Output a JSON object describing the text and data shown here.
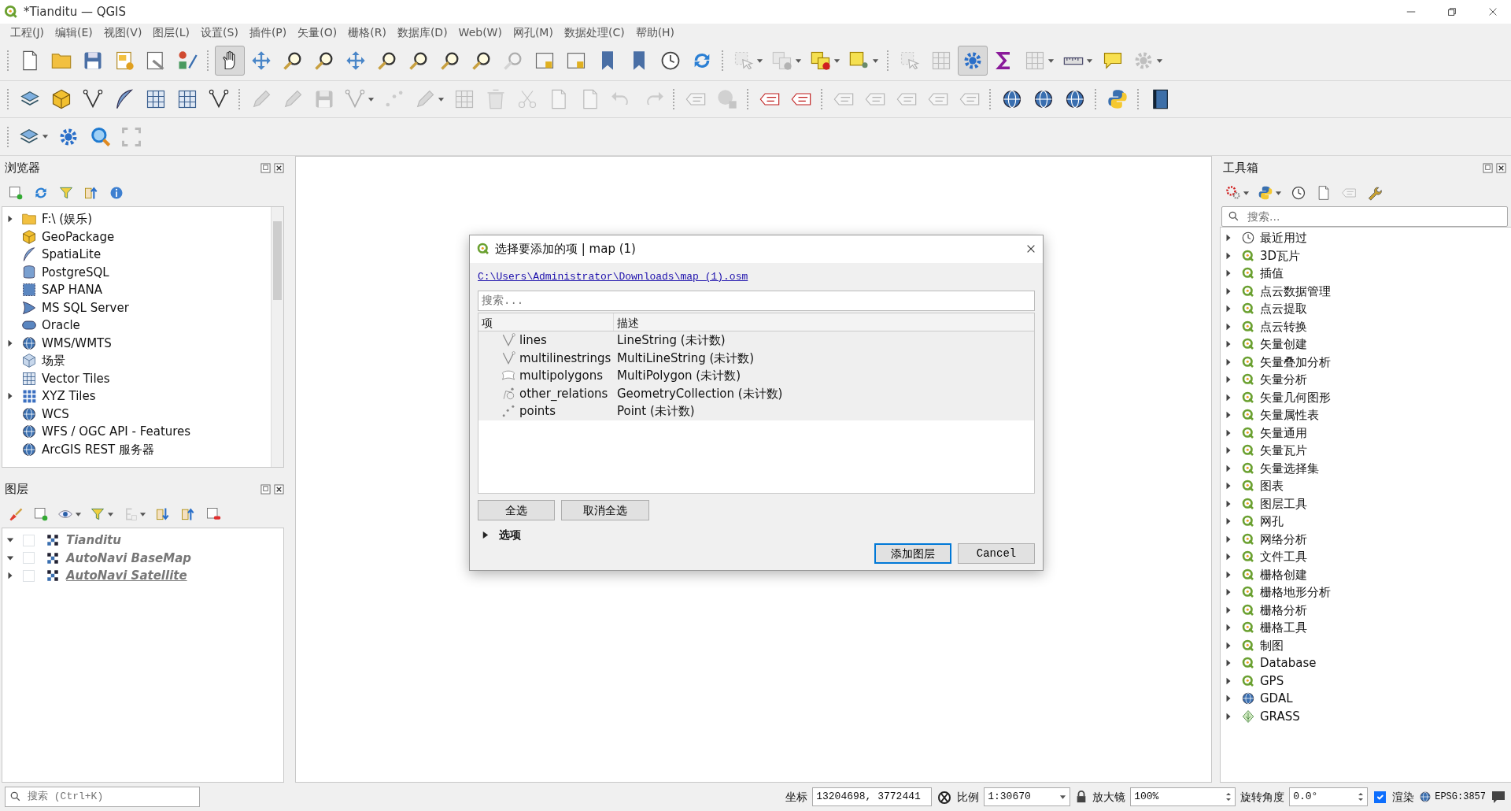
{
  "window": {
    "title": "*Tianditu — QGIS"
  },
  "menu": [
    "工程(J)",
    "编辑(E)",
    "视图(V)",
    "图层(L)",
    "设置(S)",
    "插件(P)",
    "矢量(O)",
    "栅格(R)",
    "数据库(D)",
    "Web(W)",
    "网孔(M)",
    "数据处理(C)",
    "帮助(H)"
  ],
  "toolbars": [
    {
      "groups": [
        [
          {
            "kind": "page",
            "disabled": false,
            "active": false,
            "dropdown": false
          },
          {
            "kind": "folder",
            "disabled": false,
            "active": false,
            "dropdown": false
          },
          {
            "kind": "floppy",
            "disabled": false,
            "active": false,
            "dropdown": false
          },
          {
            "kind": "layout",
            "disabled": false,
            "active": false,
            "dropdown": false
          },
          {
            "kind": "layout-manager",
            "disabled": false,
            "active": false,
            "dropdown": false
          },
          {
            "kind": "style",
            "disabled": false,
            "active": false,
            "dropdown": false
          }
        ],
        [
          {
            "kind": "hand",
            "disabled": false,
            "active": true,
            "dropdown": false
          },
          {
            "kind": "arrows",
            "disabled": false,
            "active": false,
            "dropdown": false
          },
          {
            "kind": "magnifier",
            "disabled": false,
            "active": false,
            "dropdown": false
          },
          {
            "kind": "magnifier",
            "disabled": false,
            "active": false,
            "dropdown": false
          },
          {
            "kind": "arrows",
            "disabled": false,
            "active": false,
            "dropdown": false
          },
          {
            "kind": "magnifier",
            "disabled": false,
            "active": false,
            "dropdown": false
          },
          {
            "kind": "magnifier",
            "disabled": false,
            "active": false,
            "dropdown": false
          },
          {
            "kind": "magnifier",
            "disabled": false,
            "active": false,
            "dropdown": false
          },
          {
            "kind": "magnifier",
            "disabled": false,
            "active": false,
            "dropdown": false
          },
          {
            "kind": "magnifier",
            "disabled": true,
            "active": false,
            "dropdown": false
          },
          {
            "kind": "window",
            "disabled": false,
            "active": false,
            "dropdown": false
          },
          {
            "kind": "window",
            "disabled": false,
            "active": false,
            "dropdown": false
          },
          {
            "kind": "bookmark",
            "disabled": false,
            "active": false,
            "dropdown": false
          },
          {
            "kind": "bookmark",
            "disabled": false,
            "active": false,
            "dropdown": false
          },
          {
            "kind": "clock",
            "disabled": false,
            "active": false,
            "dropdown": false
          },
          {
            "kind": "refresh",
            "disabled": false,
            "active": false,
            "dropdown": false
          }
        ],
        [
          {
            "kind": "cursor",
            "disabled": true,
            "active": false,
            "dropdown": true
          },
          {
            "kind": "squares",
            "disabled": true,
            "active": false,
            "dropdown": true
          },
          {
            "kind": "squares",
            "disabled": false,
            "active": false,
            "dropdown": true
          },
          {
            "kind": "square-pin",
            "disabled": false,
            "active": false,
            "dropdown": true
          }
        ],
        [
          {
            "kind": "cursor",
            "disabled": true,
            "active": false,
            "dropdown": false
          },
          {
            "kind": "grid",
            "disabled": true,
            "active": false,
            "dropdown": false
          },
          {
            "kind": "gear",
            "disabled": false,
            "active": true,
            "dropdown": false
          },
          {
            "kind": "sigma",
            "disabled": false,
            "active": false,
            "dropdown": false
          },
          {
            "kind": "grid",
            "disabled": true,
            "active": false,
            "dropdown": true
          },
          {
            "kind": "ruler",
            "disabled": false,
            "active": false,
            "dropdown": true
          },
          {
            "kind": "speech",
            "disabled": false,
            "active": false,
            "dropdown": false
          },
          {
            "kind": "gear",
            "disabled": true,
            "active": false,
            "dropdown": true
          }
        ]
      ]
    },
    {
      "groups": [
        [
          {
            "kind": "layers",
            "disabled": false,
            "active": false,
            "dropdown": false
          },
          {
            "kind": "cube",
            "disabled": false,
            "active": false,
            "dropdown": false
          },
          {
            "kind": "polyline",
            "disabled": false,
            "active": false,
            "dropdown": false
          },
          {
            "kind": "feather",
            "disabled": false,
            "active": false,
            "dropdown": false
          },
          {
            "kind": "grid",
            "disabled": false,
            "active": false,
            "dropdown": false
          },
          {
            "kind": "grid",
            "disabled": false,
            "active": false,
            "dropdown": false
          },
          {
            "kind": "polyline",
            "disabled": false,
            "active": false,
            "dropdown": false
          }
        ],
        [
          {
            "kind": "pencil",
            "disabled": true,
            "active": false,
            "dropdown": false
          },
          {
            "kind": "pencil",
            "disabled": true,
            "active": false,
            "dropdown": false
          },
          {
            "kind": "floppy",
            "disabled": true,
            "active": false,
            "dropdown": false
          },
          {
            "kind": "polyline",
            "disabled": true,
            "active": false,
            "dropdown": true
          },
          {
            "kind": "points",
            "disabled": true,
            "active": false,
            "dropdown": false
          },
          {
            "kind": "pencil",
            "disabled": true,
            "active": false,
            "dropdown": true
          },
          {
            "kind": "grid",
            "disabled": true,
            "active": false,
            "dropdown": false
          },
          {
            "kind": "trash",
            "disabled": true,
            "active": false,
            "dropdown": false
          },
          {
            "kind": "scissors",
            "disabled": true,
            "active": false,
            "dropdown": false
          },
          {
            "kind": "page",
            "disabled": true,
            "active": false,
            "dropdown": false
          },
          {
            "kind": "page",
            "disabled": true,
            "active": false,
            "dropdown": false
          },
          {
            "kind": "undo",
            "disabled": true,
            "active": false,
            "dropdown": false
          },
          {
            "kind": "redo",
            "disabled": true,
            "active": false,
            "dropdown": false
          }
        ],
        [
          {
            "kind": "tag",
            "disabled": true,
            "active": false,
            "dropdown": false
          },
          {
            "kind": "pie",
            "disabled": true,
            "active": false,
            "dropdown": false
          }
        ],
        [
          {
            "kind": "tag",
            "disabled": false,
            "active": false,
            "dropdown": false
          },
          {
            "kind": "tag",
            "disabled": false,
            "active": false,
            "dropdown": false
          }
        ],
        [
          {
            "kind": "tag",
            "disabled": true,
            "active": false,
            "dropdown": false
          },
          {
            "kind": "tag",
            "disabled": true,
            "active": false,
            "dropdown": false
          },
          {
            "kind": "tag",
            "disabled": true,
            "active": false,
            "dropdown": false
          },
          {
            "kind": "tag",
            "disabled": true,
            "active": false,
            "dropdown": false
          },
          {
            "kind": "tag",
            "disabled": true,
            "active": false,
            "dropdown": false
          }
        ],
        [
          {
            "kind": "globe",
            "disabled": false,
            "active": false,
            "dropdown": false
          },
          {
            "kind": "globe",
            "disabled": false,
            "active": false,
            "dropdown": false
          },
          {
            "kind": "globe",
            "disabled": false,
            "active": false,
            "dropdown": false
          }
        ],
        [
          {
            "kind": "python",
            "disabled": false,
            "active": false,
            "dropdown": false
          }
        ],
        [
          {
            "kind": "book",
            "disabled": false,
            "active": false,
            "dropdown": false
          }
        ]
      ]
    },
    {
      "groups": [
        [
          {
            "kind": "layers",
            "disabled": false,
            "active": false,
            "dropdown": true
          },
          {
            "kind": "gear",
            "disabled": false,
            "active": false,
            "dropdown": false
          },
          {
            "kind": "search",
            "disabled": false,
            "active": false,
            "dropdown": false
          },
          {
            "kind": "frame",
            "disabled": true,
            "active": false,
            "dropdown": false
          }
        ]
      ]
    }
  ],
  "browser_panel": {
    "title": "浏览器",
    "tools": [
      {
        "kind": "square-plus",
        "disabled": false,
        "dropdown": false
      },
      {
        "kind": "refresh",
        "disabled": false,
        "dropdown": false
      },
      {
        "kind": "filter",
        "disabled": false,
        "dropdown": false
      },
      {
        "kind": "collapse",
        "disabled": false,
        "dropdown": false
      },
      {
        "kind": "info",
        "disabled": false,
        "dropdown": false
      }
    ],
    "items": [
      {
        "label": "F:\\ (娱乐)",
        "kind": "folder",
        "expandable": true
      },
      {
        "label": "GeoPackage",
        "kind": "cube",
        "expandable": false
      },
      {
        "label": "SpatiaLite",
        "kind": "feather",
        "expandable": false
      },
      {
        "label": "PostgreSQL",
        "kind": "database",
        "expandable": false
      },
      {
        "label": "SAP HANA",
        "kind": "dotted-square",
        "expandable": false
      },
      {
        "label": "MS SQL Server",
        "kind": "sail",
        "expandable": false
      },
      {
        "label": "Oracle",
        "kind": "capsule",
        "expandable": false
      },
      {
        "label": "WMS/WMTS",
        "kind": "globe",
        "expandable": true
      },
      {
        "label": "场景",
        "kind": "box",
        "expandable": false
      },
      {
        "label": "Vector Tiles",
        "kind": "grid",
        "expandable": false
      },
      {
        "label": "XYZ Tiles",
        "kind": "dot-grid",
        "expandable": true
      },
      {
        "label": "WCS",
        "kind": "globe",
        "expandable": false
      },
      {
        "label": "WFS / OGC API - Features",
        "kind": "globe",
        "expandable": false
      },
      {
        "label": "ArcGIS REST 服务器",
        "kind": "globe",
        "expandable": false
      }
    ]
  },
  "layers_panel": {
    "title": "图层",
    "tools": [
      {
        "kind": "brush",
        "disabled": false,
        "dropdown": false
      },
      {
        "kind": "square-plus",
        "disabled": false,
        "dropdown": false
      },
      {
        "kind": "eye",
        "disabled": false,
        "dropdown": true
      },
      {
        "kind": "filter",
        "disabled": false,
        "dropdown": true
      },
      {
        "kind": "expression",
        "disabled": true,
        "dropdown": true
      },
      {
        "kind": "expand",
        "disabled": false,
        "dropdown": false
      },
      {
        "kind": "collapse",
        "disabled": false,
        "dropdown": false
      },
      {
        "kind": "square-minus",
        "disabled": false,
        "dropdown": false
      }
    ],
    "layers": [
      {
        "label": "Tianditu",
        "expanded": true,
        "checked": false,
        "underlined": false
      },
      {
        "label": "AutoNavi BaseMap",
        "expanded": true,
        "checked": false,
        "underlined": false
      },
      {
        "label": "AutoNavi Satellite",
        "expanded": false,
        "checked": false,
        "underlined": true
      }
    ]
  },
  "dialog": {
    "title": "选择要添加的项 | map (1)",
    "path": "C:\\Users\\Administrator\\Downloads\\map (1).osm",
    "search": {
      "placeholder": "搜索..."
    },
    "columns": [
      "项",
      "描述"
    ],
    "rows": [
      {
        "kind": "line",
        "item": "lines",
        "description": "LineString (未计数)"
      },
      {
        "kind": "line",
        "item": "multilinestrings",
        "description": "MultiLineString (未计数)"
      },
      {
        "kind": "polygon",
        "item": "multipolygons",
        "description": "MultiPolygon (未计数)"
      },
      {
        "kind": "collection",
        "item": "other_relations",
        "description": "GeometryCollection (未计数)"
      },
      {
        "kind": "point",
        "item": "points",
        "description": "Point (未计数)"
      }
    ],
    "select_buttons": [
      "全选",
      "取消全选"
    ],
    "options": {
      "label": "选项",
      "expanded": false
    },
    "buttons": [
      {
        "label": "添加图层",
        "default": true
      },
      {
        "label": "Cancel",
        "default": false
      }
    ]
  },
  "toolbox_panel": {
    "title": "工具箱",
    "tools": [
      {
        "kind": "gears",
        "disabled": false,
        "dropdown": true
      },
      {
        "kind": "python",
        "disabled": false,
        "dropdown": true
      },
      {
        "kind": "clock",
        "disabled": false,
        "dropdown": false
      },
      {
        "kind": "page",
        "disabled": false,
        "dropdown": false
      },
      {
        "kind": "tag",
        "disabled": true,
        "dropdown": false
      },
      {
        "kind": "wrench",
        "disabled": false,
        "dropdown": false
      }
    ],
    "search": {
      "placeholder": "搜索..."
    },
    "items": [
      {
        "label": "最近用过",
        "kind": "clock",
        "expanded": false
      },
      {
        "label": "3D瓦片",
        "kind": "qgis",
        "expanded": false
      },
      {
        "label": "插值",
        "kind": "qgis",
        "expanded": false
      },
      {
        "label": "点云数据管理",
        "kind": "qgis",
        "expanded": false
      },
      {
        "label": "点云提取",
        "kind": "qgis",
        "expanded": false
      },
      {
        "label": "点云转换",
        "kind": "qgis",
        "expanded": false
      },
      {
        "label": "矢量创建",
        "kind": "qgis",
        "expanded": false
      },
      {
        "label": "矢量叠加分析",
        "kind": "qgis",
        "expanded": false
      },
      {
        "label": "矢量分析",
        "kind": "qgis",
        "expanded": false
      },
      {
        "label": "矢量几何图形",
        "kind": "qgis",
        "expanded": false
      },
      {
        "label": "矢量属性表",
        "kind": "qgis",
        "expanded": false
      },
      {
        "label": "矢量通用",
        "kind": "qgis",
        "expanded": false
      },
      {
        "label": "矢量瓦片",
        "kind": "qgis",
        "expanded": false
      },
      {
        "label": "矢量选择集",
        "kind": "qgis",
        "expanded": false
      },
      {
        "label": "图表",
        "kind": "qgis",
        "expanded": false
      },
      {
        "label": "图层工具",
        "kind": "qgis",
        "expanded": false
      },
      {
        "label": "网孔",
        "kind": "qgis",
        "expanded": false
      },
      {
        "label": "网络分析",
        "kind": "qgis",
        "expanded": false
      },
      {
        "label": "文件工具",
        "kind": "qgis",
        "expanded": false
      },
      {
        "label": "栅格创建",
        "kind": "qgis",
        "expanded": false
      },
      {
        "label": "栅格地形分析",
        "kind": "qgis",
        "expanded": false
      },
      {
        "label": "栅格分析",
        "kind": "qgis",
        "expanded": false
      },
      {
        "label": "栅格工具",
        "kind": "qgis",
        "expanded": false
      },
      {
        "label": "制图",
        "kind": "qgis",
        "expanded": false
      },
      {
        "label": "Database",
        "kind": "qgis",
        "expanded": false
      },
      {
        "label": "GPS",
        "kind": "qgis",
        "expanded": false
      },
      {
        "label": "GDAL",
        "kind": "globe",
        "expanded": false
      },
      {
        "label": "GRASS",
        "kind": "leaf",
        "expanded": false
      }
    ]
  },
  "status_bar": {
    "search": {
      "placeholder": "搜索 (Ctrl+K)"
    },
    "coordinate": {
      "label": "坐标",
      "value": "13204698, 3772441"
    },
    "scale": {
      "label": "比例",
      "value": "1:30670"
    },
    "magnifier": {
      "label": "放大镜",
      "value": "100%"
    },
    "rotation": {
      "label": "旋转角度",
      "value": "0.0°"
    },
    "render": {
      "label": "渲染",
      "checked": true
    },
    "crs": "EPSG:3857"
  }
}
